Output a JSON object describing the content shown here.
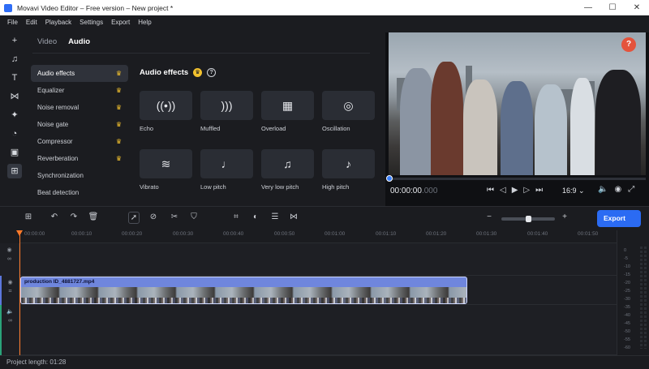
{
  "window": {
    "title": "Movavi Video Editor – Free version – New project *",
    "minimize": "—",
    "maximize": "☐",
    "close": "✕"
  },
  "menu": [
    "File",
    "Edit",
    "Playback",
    "Settings",
    "Export",
    "Help"
  ],
  "sidebar_tools": [
    "plus-icon",
    "music-icon",
    "title-icon",
    "transitions-icon",
    "magic-icon",
    "stickers-icon",
    "media-icon",
    "more-tools-icon"
  ],
  "panel": {
    "tabs": [
      {
        "label": "Video",
        "active": false
      },
      {
        "label": "Audio",
        "active": true
      }
    ],
    "heading": "Audio effects",
    "effect_list": [
      {
        "label": "Audio effects",
        "active": true,
        "premium": true
      },
      {
        "label": "Equalizer",
        "active": false,
        "premium": true
      },
      {
        "label": "Noise removal",
        "active": false,
        "premium": true
      },
      {
        "label": "Noise gate",
        "active": false,
        "premium": true
      },
      {
        "label": "Compressor",
        "active": false,
        "premium": true
      },
      {
        "label": "Reverberation",
        "active": false,
        "premium": true
      },
      {
        "label": "Synchronization",
        "active": false,
        "premium": false
      },
      {
        "label": "Beat detection",
        "active": false,
        "premium": false
      }
    ],
    "effects": [
      {
        "label": "Echo",
        "glyph": "((•))"
      },
      {
        "label": "Muffled",
        "glyph": ")))"
      },
      {
        "label": "Overload",
        "glyph": "▦"
      },
      {
        "label": "Oscillation",
        "glyph": "◎"
      },
      {
        "label": "Vibrato",
        "glyph": "≋"
      },
      {
        "label": "Low pitch",
        "glyph": "♩"
      },
      {
        "label": "Very low pitch",
        "glyph": "♫"
      },
      {
        "label": "High pitch",
        "glyph": "♪"
      }
    ]
  },
  "preview": {
    "help": "?",
    "timecode_main": "00:00:00",
    "timecode_frac": ".000",
    "aspect_ratio": "16:9",
    "aspect_caret": "⌄",
    "progress": 0.0
  },
  "timeline": {
    "export_label": "Export",
    "export_caret": "⌄",
    "ruler": [
      "00:00:00",
      "00:00:10",
      "00:00:20",
      "00:00:30",
      "00:00:40",
      "00:00:50",
      "00:01:00",
      "00:01:10",
      "00:01:20",
      "00:01:30",
      "00:01:40",
      "00:01:50"
    ],
    "clip_name": "production ID_4881727.mp4",
    "meter_labels": [
      "0",
      "-5",
      "-10",
      "-15",
      "-20",
      "-25",
      "-30",
      "-35",
      "-40",
      "-45",
      "-50",
      "-55",
      "-60"
    ]
  },
  "status": {
    "project_length": "Project length: 01:28"
  }
}
